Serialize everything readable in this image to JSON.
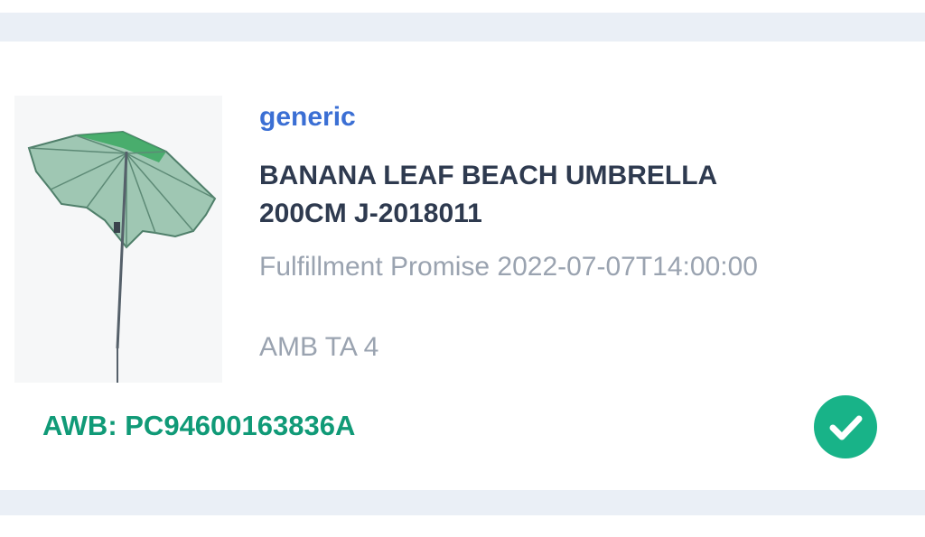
{
  "product": {
    "brand": "generic",
    "title_line1": "BANANA LEAF BEACH UMBRELLA",
    "title_line2": "200CM J-2018011",
    "fulfillment_promise": "Fulfillment Promise 2022-07-07T14:00:00",
    "location": "AMB TA 4",
    "image_icon": "umbrella-image"
  },
  "shipment": {
    "awb": "AWB: PC94600163836A",
    "status_icon": "check-circle-icon"
  },
  "colors": {
    "brand": "#3b6fd4",
    "title": "#2e3a4f",
    "muted": "#9aa3b0",
    "awb": "#109a77",
    "check": "#18b388",
    "band": "#eaeff6"
  }
}
